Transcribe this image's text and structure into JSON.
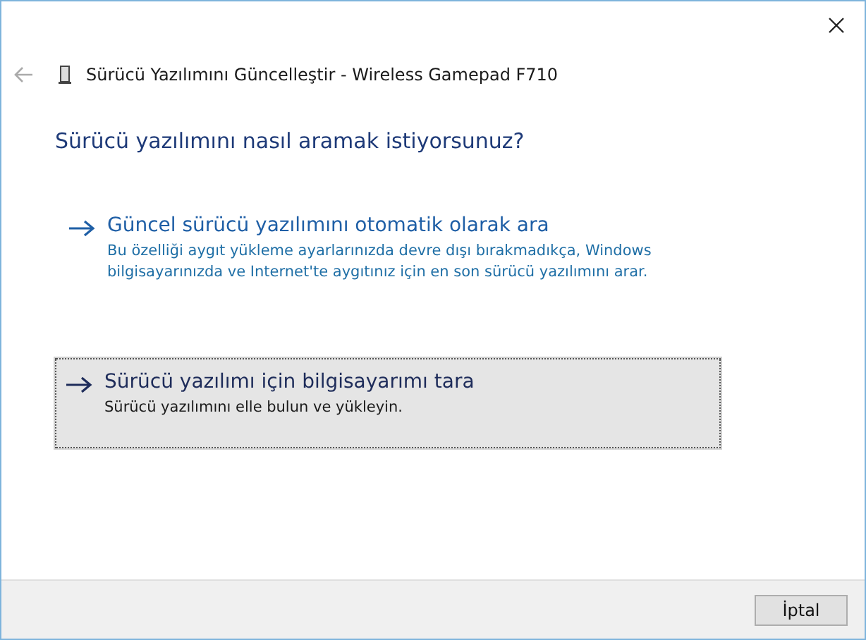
{
  "window": {
    "title": "Sürücü Yazılımını Güncelleştir - Wireless Gamepad F710"
  },
  "heading": "Sürücü yazılımını nasıl aramak istiyorsunuz?",
  "options": [
    {
      "title": "Güncel sürücü yazılımını otomatik olarak ara",
      "description": "Bu özelliği aygıt yükleme ayarlarınızda devre dışı bırakmadıkça, Windows bilgisayarınızda ve Internet'te aygıtınız için en son sürücü yazılımını arar.",
      "selected": false
    },
    {
      "title": "Sürücü yazılımı için bilgisayarımı tara",
      "description": "Sürücü yazılımını elle bulun ve yükleyin.",
      "selected": true
    }
  ],
  "buttons": [
    "İptal"
  ]
}
